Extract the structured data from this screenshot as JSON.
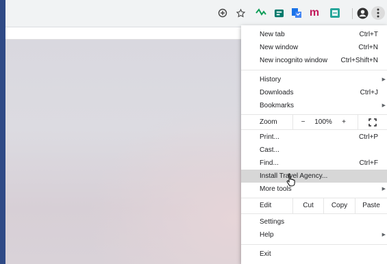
{
  "toolbar": {
    "icons": [
      "add-circle-icon",
      "star-icon",
      "ext-icon-green",
      "ext-icon-teal",
      "ext-icon-blue",
      "ext-icon-m",
      "ext-icon-cyan",
      "profile-icon",
      "menu-kebab-icon"
    ],
    "ext_m_label": "m"
  },
  "menu": {
    "new_tab": {
      "label": "New tab",
      "shortcut": "Ctrl+T"
    },
    "new_window": {
      "label": "New window",
      "shortcut": "Ctrl+N"
    },
    "new_incognito": {
      "label": "New incognito window",
      "shortcut": "Ctrl+Shift+N"
    },
    "history": {
      "label": "History"
    },
    "downloads": {
      "label": "Downloads",
      "shortcut": "Ctrl+J"
    },
    "bookmarks": {
      "label": "Bookmarks"
    },
    "zoom": {
      "label": "Zoom",
      "minus": "−",
      "value": "100%",
      "plus": "+"
    },
    "print": {
      "label": "Print...",
      "shortcut": "Ctrl+P"
    },
    "cast": {
      "label": "Cast..."
    },
    "find": {
      "label": "Find...",
      "shortcut": "Ctrl+F"
    },
    "install": {
      "label": "Install Travel Agency..."
    },
    "more_tools": {
      "label": "More tools"
    },
    "edit": {
      "label": "Edit",
      "cut": "Cut",
      "copy": "Copy",
      "paste": "Paste"
    },
    "settings": {
      "label": "Settings"
    },
    "help": {
      "label": "Help"
    },
    "exit": {
      "label": "Exit"
    }
  },
  "colors": {
    "menu_highlight": "#d7d7d7",
    "window_frame": "#2f4a86",
    "ext_green": "#0f9d58",
    "ext_red": "#c2185b"
  }
}
